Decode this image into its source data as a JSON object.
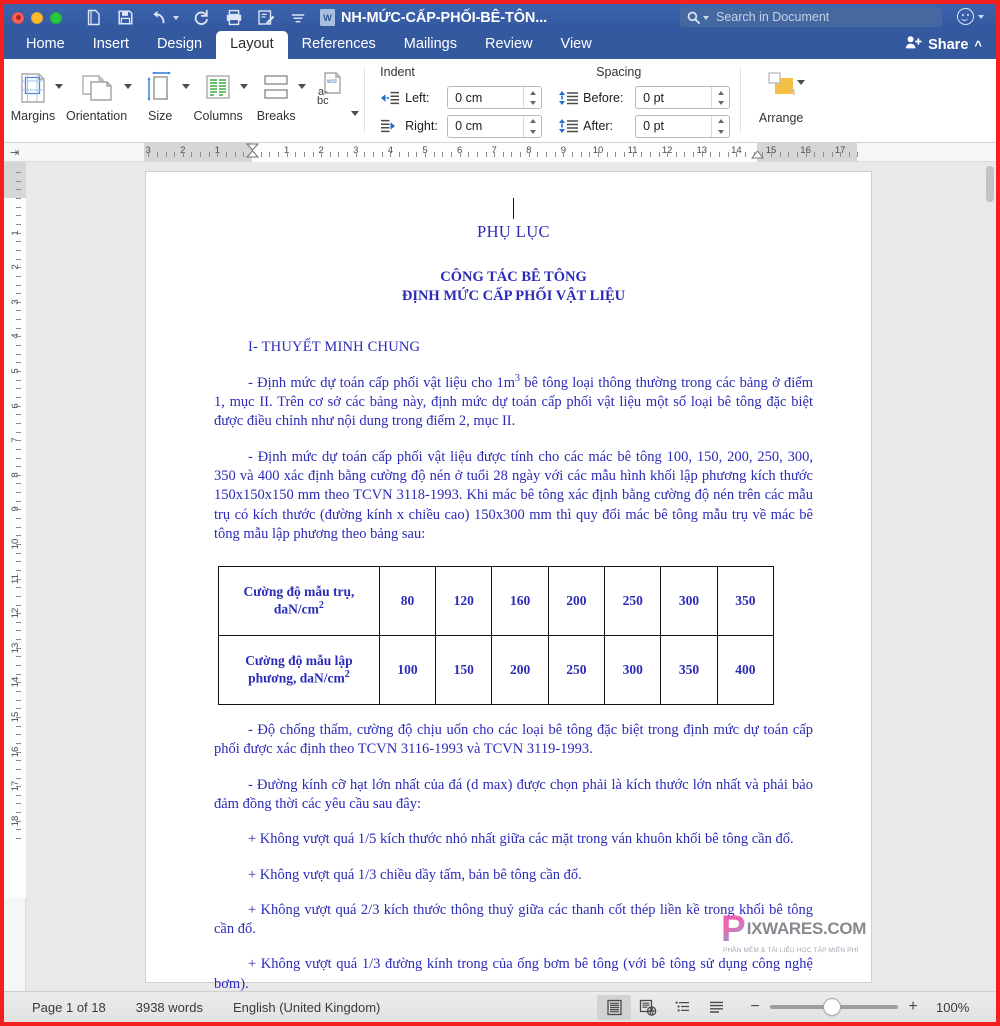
{
  "window": {
    "title": "NH-MỨC-CẤP-PHỐI-BÊ-TÔN...",
    "word_icon_letter": "W"
  },
  "search": {
    "placeholder": "Search in Document",
    "icon": "search-icon"
  },
  "quick_access": [
    {
      "name": "new-document-icon",
      "label": "New"
    },
    {
      "name": "save-icon",
      "label": "Save"
    },
    {
      "name": "undo-icon",
      "label": "Undo"
    },
    {
      "name": "redo-icon",
      "label": "Redo"
    },
    {
      "name": "print-icon",
      "label": "Print"
    },
    {
      "name": "track-changes-icon",
      "label": "Track Changes"
    },
    {
      "name": "customize-toolbar-icon",
      "label": "Customize"
    }
  ],
  "tabs": [
    {
      "label": "Home",
      "active": false
    },
    {
      "label": "Insert",
      "active": false
    },
    {
      "label": "Design",
      "active": false
    },
    {
      "label": "Layout",
      "active": true
    },
    {
      "label": "References",
      "active": false
    },
    {
      "label": "Mailings",
      "active": false
    },
    {
      "label": "Review",
      "active": false
    },
    {
      "label": "View",
      "active": false
    }
  ],
  "share": {
    "label": "Share",
    "chevron": "^"
  },
  "ribbon": {
    "buttons": [
      {
        "label": "Margins",
        "icon": "margins-icon"
      },
      {
        "label": "Orientation",
        "icon": "orientation-icon"
      },
      {
        "label": "Size",
        "icon": "size-icon"
      },
      {
        "label": "Columns",
        "icon": "columns-icon"
      },
      {
        "label": "Breaks",
        "icon": "breaks-icon"
      },
      {
        "label": "Hyphenation",
        "icon": "hyphenation-icon"
      }
    ],
    "indent": {
      "heading": "Indent",
      "left_label": "Left:",
      "left_value": "0 cm",
      "right_label": "Right:",
      "right_value": "0 cm"
    },
    "spacing": {
      "heading": "Spacing",
      "before_label": "Before:",
      "before_value": "0 pt",
      "after_label": "After:",
      "after_value": "0 pt"
    },
    "arrange": {
      "label": "Arrange",
      "icon": "arrange-icon"
    }
  },
  "ruler": {
    "horizontal_numbers": [
      "3",
      "2",
      "1",
      "1",
      "2",
      "3",
      "4",
      "5",
      "6",
      "7",
      "8",
      "9",
      "10",
      "11",
      "12",
      "13",
      "14",
      "15",
      "16",
      "17"
    ],
    "vertical_numbers": [
      "1",
      "2",
      "3",
      "4",
      "5",
      "6",
      "7",
      "8",
      "9",
      "10",
      "11",
      "12",
      "13",
      "14",
      "15",
      "16",
      "17",
      "18"
    ]
  },
  "document": {
    "title": "PHỤ LỤC",
    "subtitle_line1": "CÔNG TÁC BÊ TÔNG",
    "subtitle_line2": "ĐỊNH MỨC CẤP PHỐI VẬT LIỆU",
    "section_heading": "I- THUYẾT MINH CHUNG",
    "paragraphs_before_table": [
      "- Định mức dự toán cấp phối vật liệu cho 1m³ bê tông loại thông thường trong các bảng ở điểm 1, mục II. Trên cơ sở các bảng này, định mức dự toán cấp phối vật liệu một số loại bê tông đặc biệt được điều chỉnh như nội dung trong điểm 2, mục II.",
      "- Định mức dự toán cấp phối vật liệu được tính cho các mác bê tông 100, 150, 200, 250, 300, 350 và 400 xác định bằng cường độ nén ở tuổi 28 ngày với các mẫu hình khối lập phương kích thước 150x150x150 mm theo TCVN 3118-1993. Khi mác bê tông xác định bằng cường độ nén trên các mẫu trụ có kích thước (đường kính x chiều cao) 150x300 mm thì quy đổi mác bê tông mẫu trụ về mác bê tông mẫu lập phương theo bảng sau:"
    ],
    "table": {
      "rows": [
        {
          "header_line1": "Cường độ mẫu trụ,",
          "header_line2": "daN/cm²",
          "values": [
            "80",
            "120",
            "160",
            "200",
            "250",
            "300",
            "350"
          ]
        },
        {
          "header_line1": "Cường độ mẫu lập",
          "header_line2": "phương, daN/cm²",
          "values": [
            "100",
            "150",
            "200",
            "250",
            "300",
            "350",
            "400"
          ]
        }
      ]
    },
    "paragraphs_after_table": [
      "- Độ chống thấm, cường độ chịu uốn cho các loại bê tông đặc biệt trong định mức dự toán cấp phối được xác định theo TCVN 3116-1993 và TCVN 3119-1993.",
      "- Đường kính cỡ hạt lớn nhất của đá (d max) được chọn phải là kích thước lớn nhất và phải bảo đảm đồng thời các yêu cầu sau đây:",
      "+ Không vượt quá 1/5 kích thước nhỏ nhất giữa các mặt trong ván khuôn khối bê tông cần đổ.",
      "+ Không vượt quá 1/3 chiều dầy tấm, bản bê tông cần đổ.",
      "+ Không vượt quá 2/3 kích thước thông thuỷ giữa các thanh cốt thép liền kề trong khối bê tông cần đổ.",
      "+ Không vượt quá 1/3 đường kính trong của ống bơm bê tông (với bê tông sử dụng công nghệ bơm)."
    ]
  },
  "watermark": {
    "letter": "P",
    "text": "IXWARES.COM",
    "subtitle": "PHẦN MỀM & TÀI LIỆU HỌC TẬP MIỄN PHÍ"
  },
  "status_bar": {
    "page": "Page 1 of 18",
    "words": "3938 words",
    "language": "English (United Kingdom)",
    "view_buttons": [
      {
        "name": "print-layout-view-icon",
        "selected": true
      },
      {
        "name": "web-layout-view-icon",
        "selected": false
      },
      {
        "name": "outline-view-icon",
        "selected": false
      },
      {
        "name": "draft-view-icon",
        "selected": false
      }
    ],
    "zoom_out": "−",
    "zoom_in": "+",
    "zoom_value": "100%"
  },
  "colors": {
    "titlebar": "#32589f",
    "ribbon_tab_active": "#ffffff",
    "doc_text": "#2b2bb8",
    "border_accent": "#f42020"
  }
}
